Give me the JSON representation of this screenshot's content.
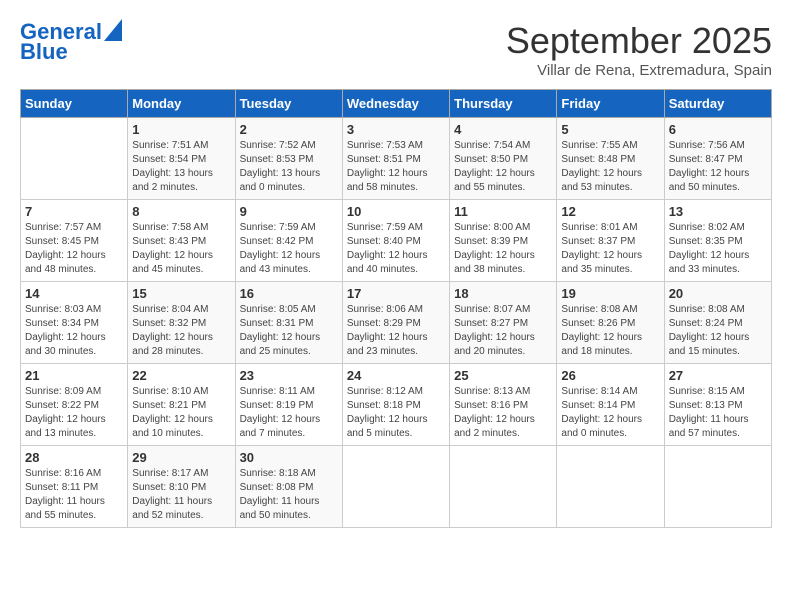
{
  "header": {
    "logo_line1": "General",
    "logo_line2": "Blue",
    "month": "September 2025",
    "location": "Villar de Rena, Extremadura, Spain"
  },
  "days_of_week": [
    "Sunday",
    "Monday",
    "Tuesday",
    "Wednesday",
    "Thursday",
    "Friday",
    "Saturday"
  ],
  "weeks": [
    [
      {
        "day": "",
        "sunrise": "",
        "sunset": "",
        "daylight": ""
      },
      {
        "day": "1",
        "sunrise": "Sunrise: 7:51 AM",
        "sunset": "Sunset: 8:54 PM",
        "daylight": "Daylight: 13 hours and 2 minutes."
      },
      {
        "day": "2",
        "sunrise": "Sunrise: 7:52 AM",
        "sunset": "Sunset: 8:53 PM",
        "daylight": "Daylight: 13 hours and 0 minutes."
      },
      {
        "day": "3",
        "sunrise": "Sunrise: 7:53 AM",
        "sunset": "Sunset: 8:51 PM",
        "daylight": "Daylight: 12 hours and 58 minutes."
      },
      {
        "day": "4",
        "sunrise": "Sunrise: 7:54 AM",
        "sunset": "Sunset: 8:50 PM",
        "daylight": "Daylight: 12 hours and 55 minutes."
      },
      {
        "day": "5",
        "sunrise": "Sunrise: 7:55 AM",
        "sunset": "Sunset: 8:48 PM",
        "daylight": "Daylight: 12 hours and 53 minutes."
      },
      {
        "day": "6",
        "sunrise": "Sunrise: 7:56 AM",
        "sunset": "Sunset: 8:47 PM",
        "daylight": "Daylight: 12 hours and 50 minutes."
      }
    ],
    [
      {
        "day": "7",
        "sunrise": "Sunrise: 7:57 AM",
        "sunset": "Sunset: 8:45 PM",
        "daylight": "Daylight: 12 hours and 48 minutes."
      },
      {
        "day": "8",
        "sunrise": "Sunrise: 7:58 AM",
        "sunset": "Sunset: 8:43 PM",
        "daylight": "Daylight: 12 hours and 45 minutes."
      },
      {
        "day": "9",
        "sunrise": "Sunrise: 7:59 AM",
        "sunset": "Sunset: 8:42 PM",
        "daylight": "Daylight: 12 hours and 43 minutes."
      },
      {
        "day": "10",
        "sunrise": "Sunrise: 7:59 AM",
        "sunset": "Sunset: 8:40 PM",
        "daylight": "Daylight: 12 hours and 40 minutes."
      },
      {
        "day": "11",
        "sunrise": "Sunrise: 8:00 AM",
        "sunset": "Sunset: 8:39 PM",
        "daylight": "Daylight: 12 hours and 38 minutes."
      },
      {
        "day": "12",
        "sunrise": "Sunrise: 8:01 AM",
        "sunset": "Sunset: 8:37 PM",
        "daylight": "Daylight: 12 hours and 35 minutes."
      },
      {
        "day": "13",
        "sunrise": "Sunrise: 8:02 AM",
        "sunset": "Sunset: 8:35 PM",
        "daylight": "Daylight: 12 hours and 33 minutes."
      }
    ],
    [
      {
        "day": "14",
        "sunrise": "Sunrise: 8:03 AM",
        "sunset": "Sunset: 8:34 PM",
        "daylight": "Daylight: 12 hours and 30 minutes."
      },
      {
        "day": "15",
        "sunrise": "Sunrise: 8:04 AM",
        "sunset": "Sunset: 8:32 PM",
        "daylight": "Daylight: 12 hours and 28 minutes."
      },
      {
        "day": "16",
        "sunrise": "Sunrise: 8:05 AM",
        "sunset": "Sunset: 8:31 PM",
        "daylight": "Daylight: 12 hours and 25 minutes."
      },
      {
        "day": "17",
        "sunrise": "Sunrise: 8:06 AM",
        "sunset": "Sunset: 8:29 PM",
        "daylight": "Daylight: 12 hours and 23 minutes."
      },
      {
        "day": "18",
        "sunrise": "Sunrise: 8:07 AM",
        "sunset": "Sunset: 8:27 PM",
        "daylight": "Daylight: 12 hours and 20 minutes."
      },
      {
        "day": "19",
        "sunrise": "Sunrise: 8:08 AM",
        "sunset": "Sunset: 8:26 PM",
        "daylight": "Daylight: 12 hours and 18 minutes."
      },
      {
        "day": "20",
        "sunrise": "Sunrise: 8:08 AM",
        "sunset": "Sunset: 8:24 PM",
        "daylight": "Daylight: 12 hours and 15 minutes."
      }
    ],
    [
      {
        "day": "21",
        "sunrise": "Sunrise: 8:09 AM",
        "sunset": "Sunset: 8:22 PM",
        "daylight": "Daylight: 12 hours and 13 minutes."
      },
      {
        "day": "22",
        "sunrise": "Sunrise: 8:10 AM",
        "sunset": "Sunset: 8:21 PM",
        "daylight": "Daylight: 12 hours and 10 minutes."
      },
      {
        "day": "23",
        "sunrise": "Sunrise: 8:11 AM",
        "sunset": "Sunset: 8:19 PM",
        "daylight": "Daylight: 12 hours and 7 minutes."
      },
      {
        "day": "24",
        "sunrise": "Sunrise: 8:12 AM",
        "sunset": "Sunset: 8:18 PM",
        "daylight": "Daylight: 12 hours and 5 minutes."
      },
      {
        "day": "25",
        "sunrise": "Sunrise: 8:13 AM",
        "sunset": "Sunset: 8:16 PM",
        "daylight": "Daylight: 12 hours and 2 minutes."
      },
      {
        "day": "26",
        "sunrise": "Sunrise: 8:14 AM",
        "sunset": "Sunset: 8:14 PM",
        "daylight": "Daylight: 12 hours and 0 minutes."
      },
      {
        "day": "27",
        "sunrise": "Sunrise: 8:15 AM",
        "sunset": "Sunset: 8:13 PM",
        "daylight": "Daylight: 11 hours and 57 minutes."
      }
    ],
    [
      {
        "day": "28",
        "sunrise": "Sunrise: 8:16 AM",
        "sunset": "Sunset: 8:11 PM",
        "daylight": "Daylight: 11 hours and 55 minutes."
      },
      {
        "day": "29",
        "sunrise": "Sunrise: 8:17 AM",
        "sunset": "Sunset: 8:10 PM",
        "daylight": "Daylight: 11 hours and 52 minutes."
      },
      {
        "day": "30",
        "sunrise": "Sunrise: 8:18 AM",
        "sunset": "Sunset: 8:08 PM",
        "daylight": "Daylight: 11 hours and 50 minutes."
      },
      {
        "day": "",
        "sunrise": "",
        "sunset": "",
        "daylight": ""
      },
      {
        "day": "",
        "sunrise": "",
        "sunset": "",
        "daylight": ""
      },
      {
        "day": "",
        "sunrise": "",
        "sunset": "",
        "daylight": ""
      },
      {
        "day": "",
        "sunrise": "",
        "sunset": "",
        "daylight": ""
      }
    ]
  ]
}
